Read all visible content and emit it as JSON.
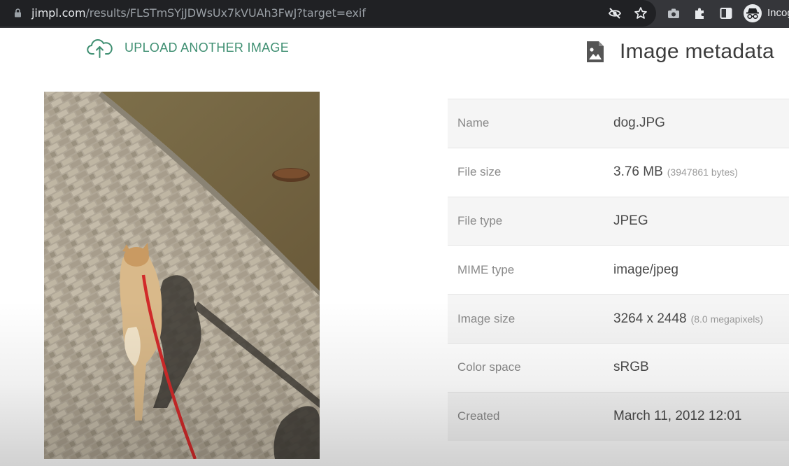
{
  "browser": {
    "url_host": "jimpl.com",
    "url_path": "/results/FLSTmSYjJDWsUx7kVUAh3FwJ?target=exif",
    "profile_label": "Incog"
  },
  "upload": {
    "label": "UPLOAD ANOTHER IMAGE"
  },
  "metadata": {
    "title": "Image metadata",
    "rows": [
      {
        "label": "Name",
        "value": "dog.JPG",
        "note": ""
      },
      {
        "label": "File size",
        "value": "3.76 MB",
        "note": "(3947861 bytes)"
      },
      {
        "label": "File type",
        "value": "JPEG",
        "note": ""
      },
      {
        "label": "MIME type",
        "value": "image/jpeg",
        "note": ""
      },
      {
        "label": "Image size",
        "value": "3264 x 2448",
        "note": "(8.0 megapixels)"
      },
      {
        "label": "Color space",
        "value": "sRGB",
        "note": ""
      },
      {
        "label": "Created",
        "value": "March 11, 2012 12:01",
        "note": ""
      }
    ]
  },
  "colors": {
    "accent": "#3f8f72",
    "leash": "#d12a2a"
  }
}
